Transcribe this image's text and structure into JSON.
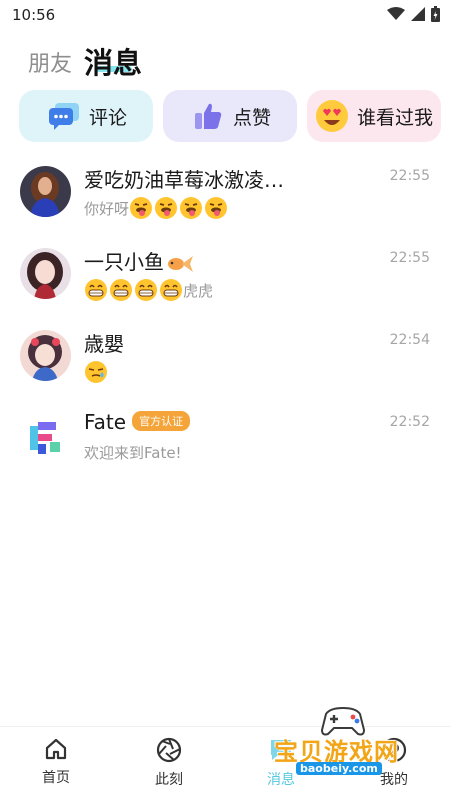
{
  "status_bar": {
    "time": "10:56"
  },
  "header": {
    "tab_friends": "朋友",
    "tab_messages": "消息"
  },
  "quick_actions": [
    {
      "label": "评论",
      "icon": "comment-bubble-icon",
      "color": "#dff4f9"
    },
    {
      "label": "点赞",
      "icon": "thumbs-up-icon",
      "color": "#e9e8fb"
    },
    {
      "label": "谁看过我",
      "icon": "heart-eyes-emoji-icon",
      "color": "#fde7ee"
    }
  ],
  "messages": [
    {
      "name": "爱吃奶油草莓冰激凌…",
      "time": "22:55",
      "preview_text": "你好呀",
      "emoji": "tongue-emoji",
      "emoji_count": 4
    },
    {
      "name": "一只小鱼",
      "time": "22:55",
      "preview_text": "虎虎",
      "emoji": "grin-emoji",
      "emoji_count": 4
    },
    {
      "name": "歳嬰",
      "time": "22:54",
      "preview_text": "",
      "emoji": "sleepy-emoji",
      "emoji_count": 1
    },
    {
      "name": "Fate",
      "badge": "官方认证",
      "time": "22:52",
      "preview_text": "欢迎来到Fate!"
    }
  ],
  "bottom_nav": [
    {
      "label": "首页",
      "icon": "home-icon"
    },
    {
      "label": "此刻",
      "icon": "aperture-icon"
    },
    {
      "label": "消息",
      "icon": "message-icon",
      "active": true
    },
    {
      "label": "我的",
      "icon": "profile-icon"
    }
  ],
  "watermark": {
    "title": "宝贝游戏网",
    "url": "baobeiy.com"
  },
  "colors": {
    "accent": "#56c8e0",
    "badge": "#f5a43a"
  }
}
